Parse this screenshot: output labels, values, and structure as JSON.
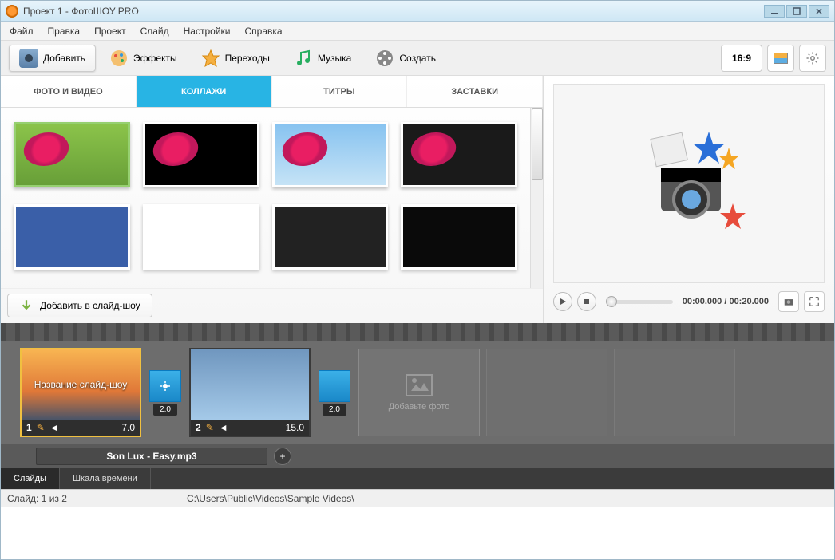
{
  "title": "Проект 1 - ФотоШОУ PRO",
  "menu": [
    "Файл",
    "Правка",
    "Проект",
    "Слайд",
    "Настройки",
    "Справка"
  ],
  "toolbar": {
    "add": "Добавить",
    "effects": "Эффекты",
    "transitions": "Переходы",
    "music": "Музыка",
    "create": "Создать",
    "ratio": "16:9"
  },
  "subtabs": [
    "ФОТО И ВИДЕО",
    "КОЛЛАЖИ",
    "ТИТРЫ",
    "ЗАСТАВКИ"
  ],
  "add_to_slideshow": "Добавить в слайд-шоу",
  "preview": {
    "time": "00:00.000 / 00:20.000"
  },
  "timeline": {
    "slides": [
      {
        "num": "1",
        "duration": "7.0",
        "caption": "Название слайд-шоу"
      },
      {
        "num": "2",
        "duration": "15.0",
        "caption": ""
      }
    ],
    "transitions": [
      "2.0",
      "2.0"
    ],
    "placeholder": "Добавьте фото",
    "audio": "Son Lux - Easy.mp3"
  },
  "view_tabs": [
    "Слайды",
    "Шкала времени"
  ],
  "status": {
    "slide_info": "Слайд: 1 из 2",
    "path": "C:\\Users\\Public\\Videos\\Sample Videos\\"
  }
}
